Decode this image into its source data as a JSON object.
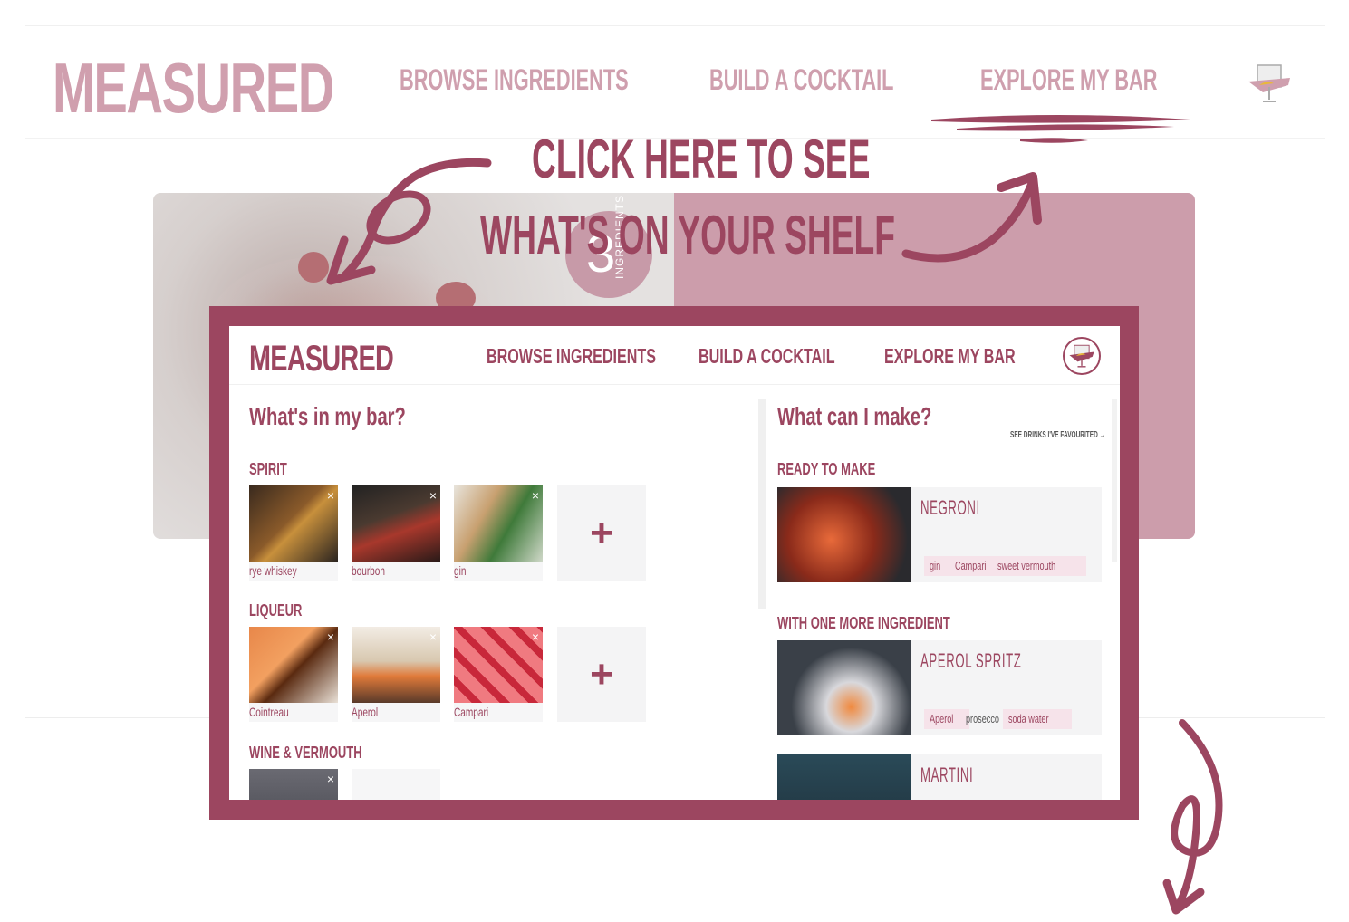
{
  "background_page": {
    "logo": "MEASURED",
    "nav": [
      "BROWSE INGREDIENTS",
      "BUILD A COCKTAIL",
      "EXPLORE MY BAR"
    ],
    "hero_badge": {
      "number": "3",
      "label": "INGREDIENTS"
    }
  },
  "annotation": {
    "line1": "CLICK HERE TO SEE",
    "line2": "WHAT'S ON YOUR SHELF"
  },
  "app": {
    "logo": "MEASURED",
    "nav": [
      "BROWSE INGREDIENTS",
      "BUILD A COCKTAIL",
      "EXPLORE MY BAR"
    ],
    "left": {
      "title": "What's in my bar?",
      "categories": [
        {
          "name": "SPIRIT",
          "items": [
            "rye whiskey",
            "bourbon",
            "gin"
          ]
        },
        {
          "name": "LIQUEUR",
          "items": [
            "Cointreau",
            "Aperol",
            "Campari"
          ]
        },
        {
          "name": "WINE & VERMOUTH",
          "items": []
        }
      ],
      "add_symbol": "+",
      "remove_symbol": "×"
    },
    "right": {
      "title": "What can I make?",
      "see_favourited": "SEE DRINKS I'VE FAVOURITED →",
      "sections": [
        {
          "label": "READY TO MAKE",
          "drinks": [
            {
              "name": "NEGRONI",
              "tags": [
                {
                  "t": "gin",
                  "have": true
                },
                {
                  "t": "Campari",
                  "have": true
                },
                {
                  "t": "sweet vermouth",
                  "have": true
                }
              ]
            }
          ]
        },
        {
          "label": "WITH ONE MORE INGREDIENT",
          "drinks": [
            {
              "name": "APEROL SPRITZ",
              "tags": [
                {
                  "t": "Aperol",
                  "have": true
                },
                {
                  "t": "prosecco",
                  "have": false
                },
                {
                  "t": "soda water",
                  "have": true
                }
              ]
            },
            {
              "name": "MARTINI",
              "tags": []
            }
          ]
        }
      ]
    }
  },
  "colors": {
    "brand": "#9c4660",
    "brand_light": "#cc9dab",
    "tag_bg": "#f6e3ea"
  }
}
